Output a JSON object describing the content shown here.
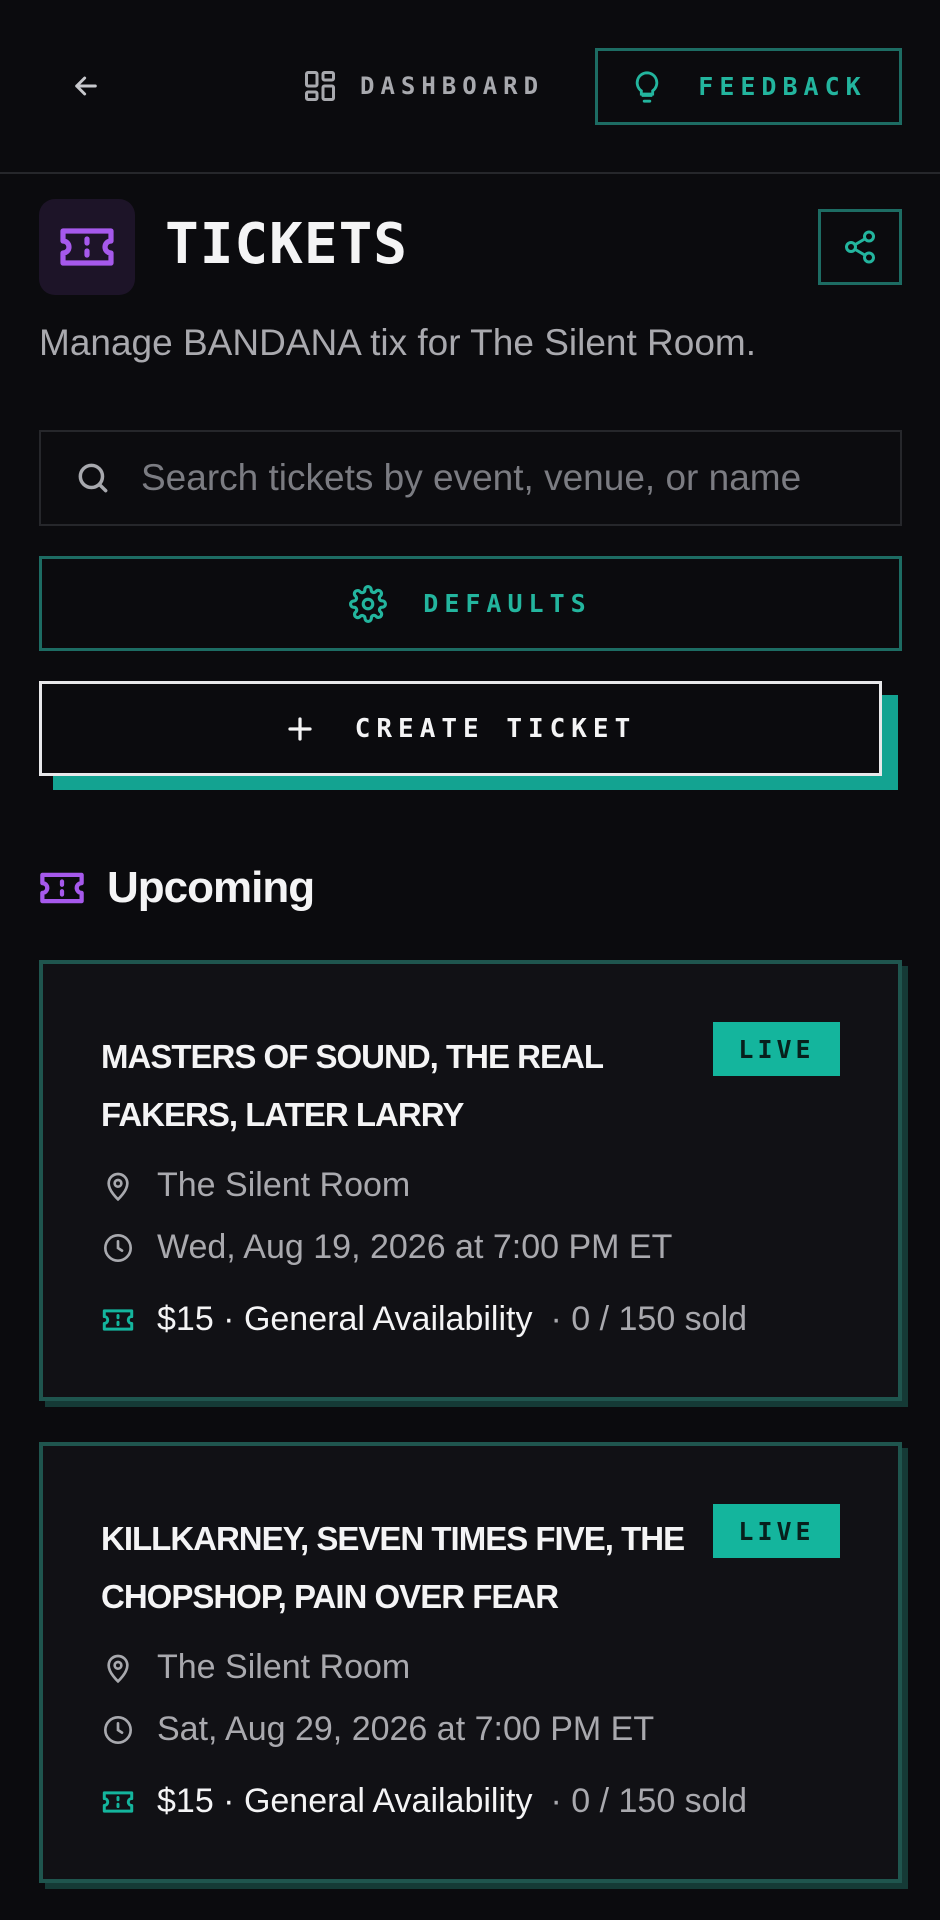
{
  "header": {
    "dashboard_label": "DASHBOARD",
    "feedback_label": "FEEDBACK"
  },
  "page": {
    "title": "TICKETS",
    "subtitle": "Manage BANDANA tix for The Silent Room."
  },
  "search": {
    "placeholder": "Search tickets by event, venue, or name",
    "value": ""
  },
  "actions": {
    "defaults_label": "DEFAULTS",
    "create_label": "CREATE TICKET"
  },
  "section": {
    "title": "Upcoming"
  },
  "events": [
    {
      "title": "MASTERS OF SOUND, THE REAL FAKERS, LATER LARRY",
      "status": "LIVE",
      "venue": "The Silent Room",
      "datetime": "Wed, Aug 19, 2026 at 7:00 PM ET",
      "price": "$15 · General Availability",
      "sold": "· 0 / 150 sold"
    },
    {
      "title": "KILLKARNEY, SEVEN TIMES FIVE, THE CHOPSHOP, PAIN OVER FEAR",
      "status": "LIVE",
      "venue": "The Silent Room",
      "datetime": "Sat, Aug 29, 2026 at 7:00 PM ET",
      "price": "$15 · General Availability",
      "sold": "· 0 / 150 sold"
    }
  ],
  "colors": {
    "accent_teal": "#14b59d",
    "accent_purple": "#9b5de5",
    "background": "#0b0b0e"
  },
  "icons": [
    "arrow-left-icon",
    "dashboard-grid-icon",
    "lightbulb-icon",
    "ticket-icon",
    "share-icon",
    "search-icon",
    "gear-icon",
    "plus-icon",
    "map-pin-icon",
    "clock-icon"
  ]
}
